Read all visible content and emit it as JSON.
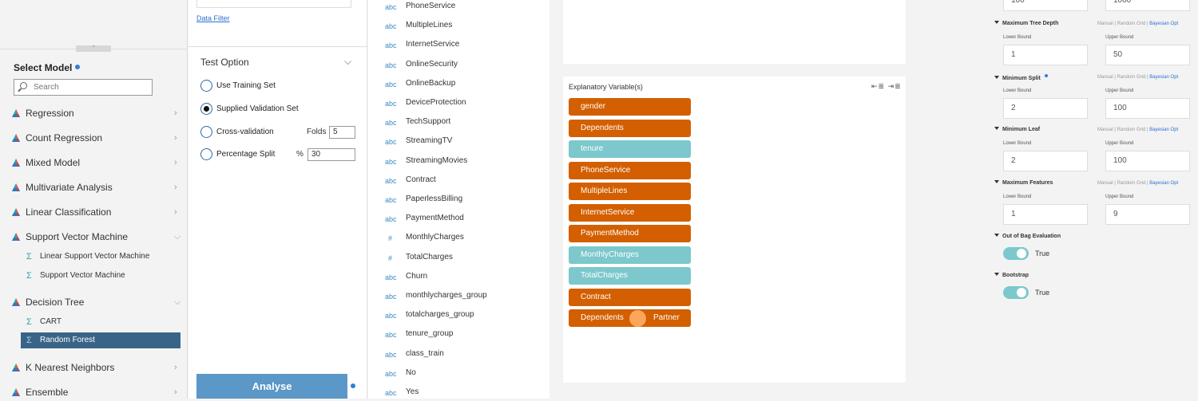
{
  "left": {
    "grip_icon": "chevron-up",
    "select_title": "Select Model",
    "search_placeholder": "Search",
    "categories": [
      {
        "label": "Regression",
        "expanded": false
      },
      {
        "label": "Count Regression",
        "expanded": false
      },
      {
        "label": "Mixed Model",
        "expanded": false
      },
      {
        "label": "Multivariate Analysis",
        "expanded": false
      },
      {
        "label": "Linear Classification",
        "expanded": false
      },
      {
        "label": "Support Vector Machine",
        "expanded": true
      },
      {
        "label": "Decision Tree",
        "expanded": true
      },
      {
        "label": "K Nearest Neighbors",
        "expanded": false
      },
      {
        "label": "Ensemble",
        "expanded": false
      }
    ],
    "svm_items": [
      "Linear Support Vector Machine",
      "Support Vector Machine"
    ],
    "tree_items": [
      "CART",
      "Random Forest"
    ],
    "active_item": "Random Forest"
  },
  "middle": {
    "data_filter": "Data Filter",
    "test_option_title": "Test Option",
    "options": [
      "Use Training Set",
      "Supplied Validation Set",
      "Cross-validation",
      "Percentage Split"
    ],
    "selected_option": "Supplied Validation Set",
    "folds_label": "Folds",
    "folds_value": "5",
    "percent_label": "%",
    "percent_value": "30",
    "analyse": "Analyse"
  },
  "variables": [
    {
      "type": "abc",
      "name": "PhoneService"
    },
    {
      "type": "abc",
      "name": "MultipleLines"
    },
    {
      "type": "abc",
      "name": "InternetService"
    },
    {
      "type": "abc",
      "name": "OnlineSecurity"
    },
    {
      "type": "abc",
      "name": "OnlineBackup"
    },
    {
      "type": "abc",
      "name": "DeviceProtection"
    },
    {
      "type": "abc",
      "name": "TechSupport"
    },
    {
      "type": "abc",
      "name": "StreamingTV"
    },
    {
      "type": "abc",
      "name": "StreamingMovies"
    },
    {
      "type": "abc",
      "name": "Contract"
    },
    {
      "type": "abc",
      "name": "PaperlessBilling"
    },
    {
      "type": "abc",
      "name": "PaymentMethod"
    },
    {
      "type": "#",
      "name": "MonthlyCharges"
    },
    {
      "type": "#",
      "name": "TotalCharges"
    },
    {
      "type": "abc",
      "name": "Churn"
    },
    {
      "type": "abc",
      "name": "monthlycharges_group"
    },
    {
      "type": "abc",
      "name": "totalcharges_group"
    },
    {
      "type": "abc",
      "name": "tenure_group"
    },
    {
      "type": "abc",
      "name": "class_train"
    },
    {
      "type": "abc",
      "name": "No"
    },
    {
      "type": "abc",
      "name": "Yes"
    }
  ],
  "explanatory": {
    "title": "Explanatory Variable(s)",
    "icons": "⇤≣ ⇥≣",
    "pills": [
      {
        "label": "gender",
        "kind": "cat"
      },
      {
        "label": "Dependents",
        "kind": "cat"
      },
      {
        "label": "tenure",
        "kind": "num"
      },
      {
        "label": "PhoneService",
        "kind": "cat"
      },
      {
        "label": "MultipleLines",
        "kind": "cat"
      },
      {
        "label": "InternetService",
        "kind": "cat"
      },
      {
        "label": "PaymentMethod",
        "kind": "cat"
      },
      {
        "label": "MonthlyCharges",
        "kind": "num"
      },
      {
        "label": "TotalCharges",
        "kind": "num"
      },
      {
        "label": "Contract",
        "kind": "cat"
      }
    ],
    "drag_pill": {
      "label": "Dependents",
      "label2": "Partner"
    }
  },
  "params": {
    "top_values": [
      "100",
      "1000"
    ],
    "sections": [
      {
        "title": "Maximum Tree Depth",
        "lower": "1",
        "upper": "50",
        "dot": false
      },
      {
        "title": "Minimum Split",
        "lower": "2",
        "upper": "100",
        "dot": true
      },
      {
        "title": "Minimum Leaf",
        "lower": "2",
        "upper": "100",
        "dot": false
      },
      {
        "title": "Maximum Features",
        "lower": "1",
        "upper": "9",
        "dot": false
      }
    ],
    "lower_label": "Lower Bound",
    "upper_label": "Upper Bound",
    "opt_manual": "Manual",
    "opt_sep": " | ",
    "opt_grid": "Random Grid",
    "opt_bayes": "Bayesian Opt",
    "oob_title": "Out of Bag Evaluation",
    "oob_value": "True",
    "bootstrap_title": "Bootstrap",
    "bootstrap_value": "True",
    "accent": "#2f6fd0",
    "cat_color": "#d35f00",
    "num_color": "#7cc8cc"
  }
}
